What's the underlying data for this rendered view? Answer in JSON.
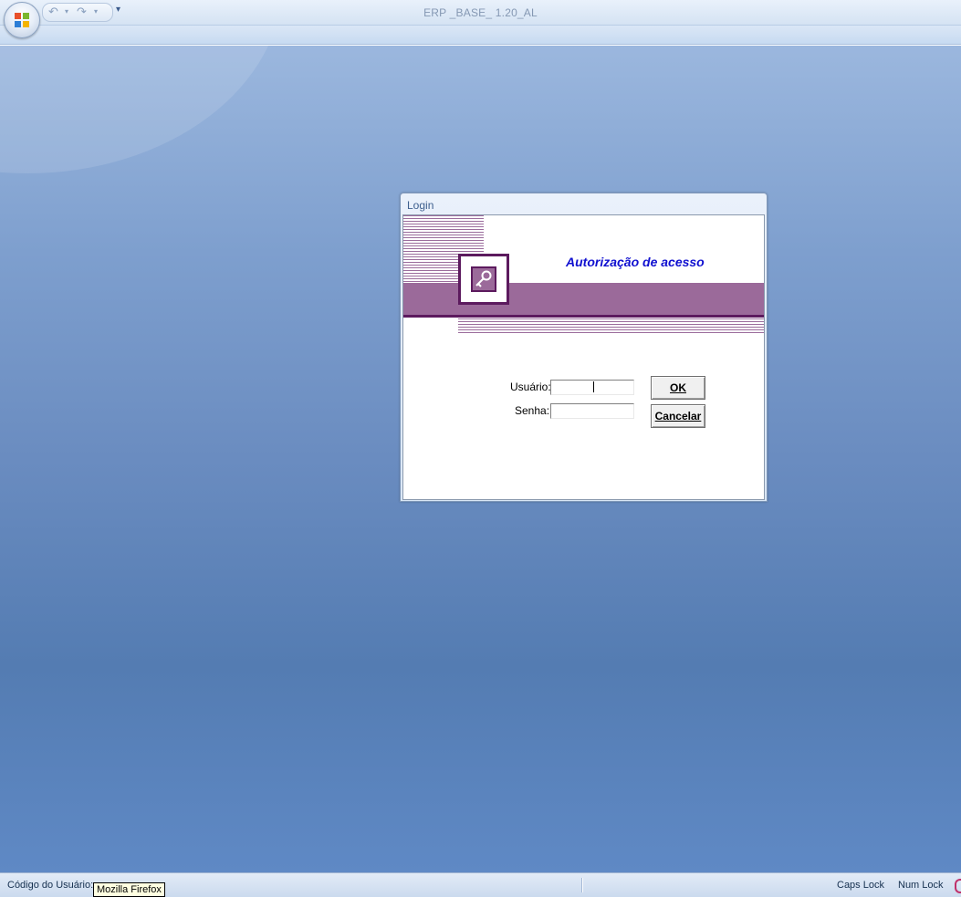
{
  "window": {
    "title": "ERP _BASE_ 1.20_AL"
  },
  "quick_access": {
    "undo_icon": "undo-icon",
    "redo_icon": "redo-icon",
    "customize_icon": "customize-qat-icon"
  },
  "login_dialog": {
    "title": "Login",
    "header": "Autorização de acesso",
    "user_label": "Usuário:",
    "user_value": "",
    "password_label": "Senha:",
    "password_value": "",
    "ok_button": "OK",
    "cancel_button": "Cancelar",
    "accent_color": "#9b6a9a",
    "dark_accent_color": "#5c1a5e",
    "header_color": "#1010d0"
  },
  "status_bar": {
    "left_text": "Código do Usuário: ",
    "caps_lock": "Caps Lock",
    "num_lock": "Num Lock"
  },
  "tooltip": {
    "text": "Mozilla Firefox"
  }
}
